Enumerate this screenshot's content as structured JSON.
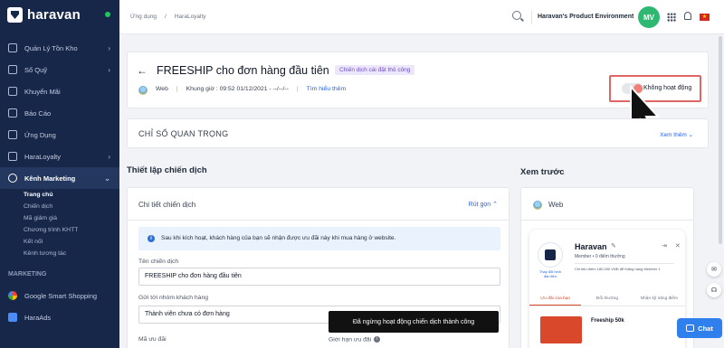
{
  "brand": {
    "name": "haravan"
  },
  "sidebar": {
    "items": [
      {
        "label": "Quản Lý Tồn Kho",
        "chevron": "›"
      },
      {
        "label": "Sổ Quỹ",
        "chevron": "›"
      },
      {
        "label": "Khuyến Mãi"
      },
      {
        "label": "Báo Cáo"
      },
      {
        "label": "Ứng Dụng"
      },
      {
        "label": "HaraLoyalty",
        "chevron": "›"
      },
      {
        "label": "Kênh Marketing",
        "chevron": "⌄"
      }
    ],
    "subitems": [
      "Trang chủ",
      "Chiến dịch",
      "Mã giảm giá",
      "Chương trình KHTT",
      "Kết nối",
      "Kênh tương tác"
    ],
    "section": "MARKETING",
    "section_items": [
      "Google Smart Shopping",
      "HaraAds"
    ]
  },
  "topbar": {
    "breadcrumbs": [
      "Ứng dụng",
      "/",
      "HaraLoyalty"
    ],
    "env": "Haravan's Product Environment",
    "avatar": "MV",
    "flag": "★"
  },
  "campaign": {
    "back": "←",
    "title": "FREESHIP cho đơn hàng đầu tiên",
    "tag": "Chiến dịch cài đặt thủ công",
    "channel": "Web",
    "sep": "|",
    "timeframe": "Khung giờ : 09:52 01/12/2021 - --/--/--",
    "learn_more": "Tìm hiểu thêm",
    "status": "Không hoạt động",
    "status_on": false
  },
  "kpi": {
    "title": "CHỈ SỐ QUAN TRỌNG",
    "more": "Xem thêm ⌄"
  },
  "setup": {
    "heading": "Thiết lập chiến dịch",
    "card_title": "Chi tiết chiến dịch",
    "collapse": "Rút gọn ⌃",
    "info_icon": "i",
    "info": "Sau khi kích hoạt, khách hàng của bạn sẽ nhận được ưu đãi này khi mua hàng ở website.",
    "name_label": "Tên chiến dịch",
    "name_value": "FREESHIP cho đơn hàng đầu tiên",
    "group_label": "Gửi tới nhóm khách hàng",
    "group_value": "Thành viên chưa có đơn hàng",
    "code_label": "Mã ưu đãi",
    "limit_label": "Giới hạn ưu đãi"
  },
  "toast": "Đã ngừng hoạt động chiến dịch thành công",
  "preview": {
    "heading": "Xem trước",
    "channel": "Web",
    "brand_name": "Haravan",
    "brand_tag": "Thay đổi hình đại diện",
    "pencil": "✎",
    "member": "Member • 0 điểm thưởng",
    "info": "Chi tiêu thêm 180,000 VNĐ để thăng hạng Member 1",
    "icons": [
      "⇥",
      "✕"
    ],
    "tabs": [
      "Ưu đãi của bạn",
      "Đổi thưởng",
      "Nhận kỹ năng điểm"
    ],
    "voucher_text": "Freeship 50k"
  },
  "tools": {
    "mail": "✉",
    "support": "☊",
    "chat": "Chat"
  }
}
